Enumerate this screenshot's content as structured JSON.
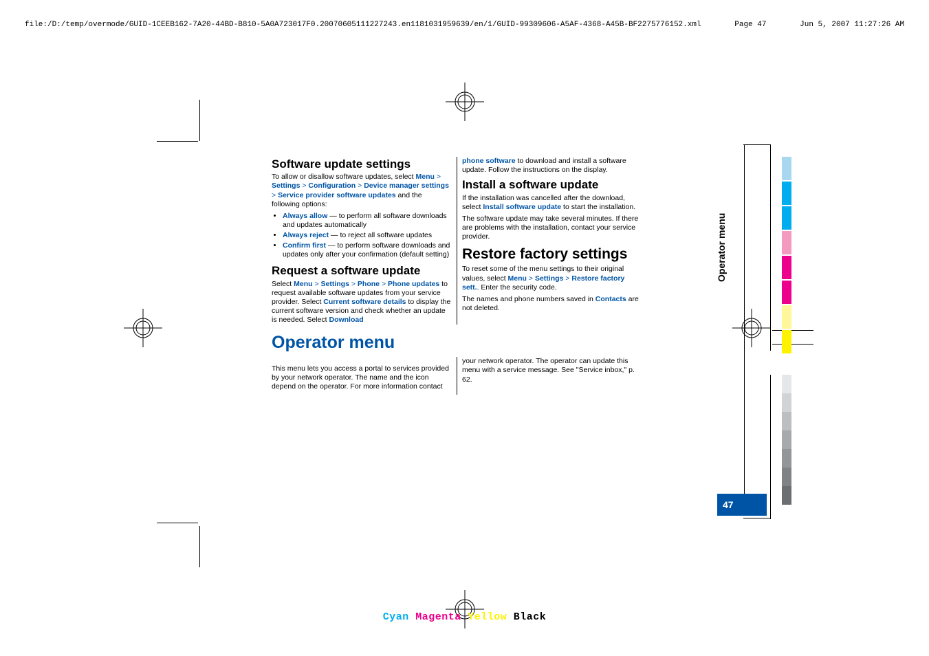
{
  "header": {
    "filepath": "file:/D:/temp/overmode/GUID-1CEEB162-7A20-44BD-B810-5A0A723017F0.20070605111227243.en1181031959639/en/1/GUID-99309606-A5AF-4368-A45B-BF2275776152.xml",
    "page_label": "Page  47",
    "timestamp": "Jun 5, 2007 11:27:26 AM"
  },
  "side_tab": "Operator menu",
  "page_number": "47",
  "cmyk": {
    "c": "Cyan",
    "m": "Magenta",
    "y": "Yellow",
    "k": "Black"
  },
  "colorbars_top": [
    "#a7d8ef",
    "#00aeef",
    "#00aeef",
    "#f49ac1",
    "#ec008c",
    "#ec008c",
    "#fff799",
    "#fff200"
  ],
  "colorbars_bottom": [
    "#e6e7e8",
    "#d1d3d4",
    "#bcbec0",
    "#a7a9ac",
    "#939598",
    "#808285",
    "#6d6e71"
  ],
  "sections": {
    "sus": {
      "heading": "Software update settings",
      "intro_pre": "To allow or disallow software updates, select ",
      "menu_path": [
        "Menu",
        "Settings",
        "Configuration",
        "Device manager settings",
        "Service provider software updates"
      ],
      "intro_post": " and the following options:",
      "bullets": [
        {
          "term": "Always allow",
          "text": " — to perform all software downloads and updates automatically"
        },
        {
          "term": "Always reject",
          "text": " — to reject all software updates"
        },
        {
          "term": "Confirm first",
          "text": " — to perform software downloads and updates only after your confirmation (default setting)"
        }
      ]
    },
    "rsu": {
      "heading": "Request a software update",
      "p1_pre": "Select ",
      "menu_path1": [
        "Menu",
        "Settings",
        "Phone",
        "Phone updates"
      ],
      "p1_mid": " to request available software updates from your service provider. Select ",
      "csd": "Current software details",
      "p1_post": " to display the current software version and check whether an update is needed. Select ",
      "dl": "Download phone software",
      "p1_tail": " to download and install a software update. Follow the instructions on the display."
    },
    "isu": {
      "heading": "Install a software update",
      "p1_pre": "If the installation was cancelled after the download, select ",
      "isu_link": "Install software update",
      "p1_post": " to start the installation.",
      "p2": "The software update may take several minutes. If there are problems with the installation, contact your service provider."
    },
    "rfs": {
      "heading": "Restore factory settings",
      "p1_pre": "To reset some of the menu settings to their original values, select ",
      "menu_path": [
        "Menu",
        "Settings",
        "Restore factory sett."
      ],
      "p1_post": ". Enter the security code.",
      "p2_pre": "The names and phone numbers saved in ",
      "contacts": "Contacts",
      "p2_post": " are not deleted."
    },
    "opm": {
      "heading": "Operator menu",
      "left": "This menu lets you access a portal to services provided by your network operator. The name and the icon depend on the operator. For more information contact",
      "right": "your network operator. The operator can update this menu with a service message. See \"Service inbox,\" p. 62."
    }
  }
}
